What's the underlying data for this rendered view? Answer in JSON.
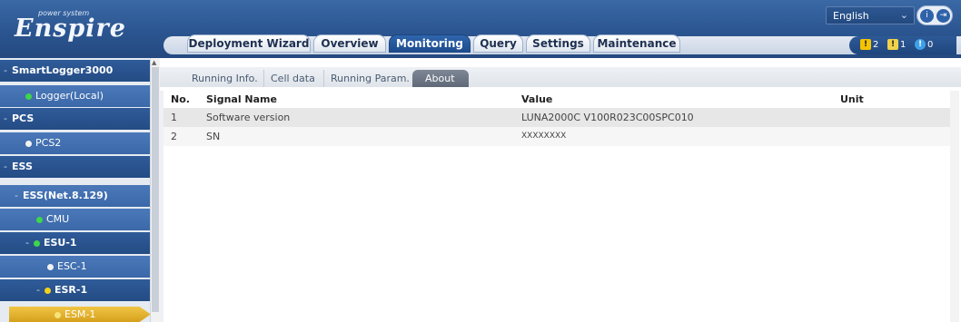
{
  "header": {
    "logo": "Enspire",
    "logo_sub": "power system",
    "language": "English",
    "lang_arrow": "⌄",
    "icon_info": "i",
    "icon_logout": "⇥"
  },
  "nav": {
    "tabs": [
      {
        "label": "Deployment Wizard"
      },
      {
        "label": "Overview"
      },
      {
        "label": "Monitoring"
      },
      {
        "label": "Query"
      },
      {
        "label": "Settings"
      },
      {
        "label": "Maintenance"
      }
    ],
    "active": "Monitoring"
  },
  "alarms": {
    "major": "2",
    "minor": "1",
    "warning": "0",
    "colors": {
      "major": "#f5c400",
      "minor": "#f0d24a",
      "warning": "#3ea0e8"
    }
  },
  "sidebar": {
    "items": [
      {
        "label": "SmartLogger3000",
        "style": "dark"
      },
      {
        "label": "Logger(Local)",
        "style": "light"
      },
      {
        "label": "PCS",
        "style": "dark"
      },
      {
        "label": "PCS2",
        "style": "light"
      },
      {
        "label": "ESS",
        "style": "dark"
      },
      {
        "label": "ESS(Net.8.129)",
        "style": "light"
      },
      {
        "label": "CMU",
        "style": "light"
      },
      {
        "label": "ESU-1",
        "style": "dark"
      },
      {
        "label": "ESC-1",
        "style": "light"
      },
      {
        "label": "ESR-1",
        "style": "dark"
      },
      {
        "label": "ESM-1",
        "style": "selected"
      }
    ]
  },
  "subtabs": [
    {
      "label": "Running Info."
    },
    {
      "label": "Cell data"
    },
    {
      "label": "Running Param."
    },
    {
      "label": "About"
    }
  ],
  "table": {
    "headers": {
      "no": "No.",
      "name": "Signal Name",
      "value": "Value",
      "unit": "Unit"
    },
    "rows": [
      {
        "no": "1",
        "name": "Software version",
        "value": "LUNA2000C V100R023C00SPC010",
        "unit": ""
      },
      {
        "no": "2",
        "name": "SN",
        "value": "XXXXXXXX",
        "unit": ""
      }
    ]
  }
}
